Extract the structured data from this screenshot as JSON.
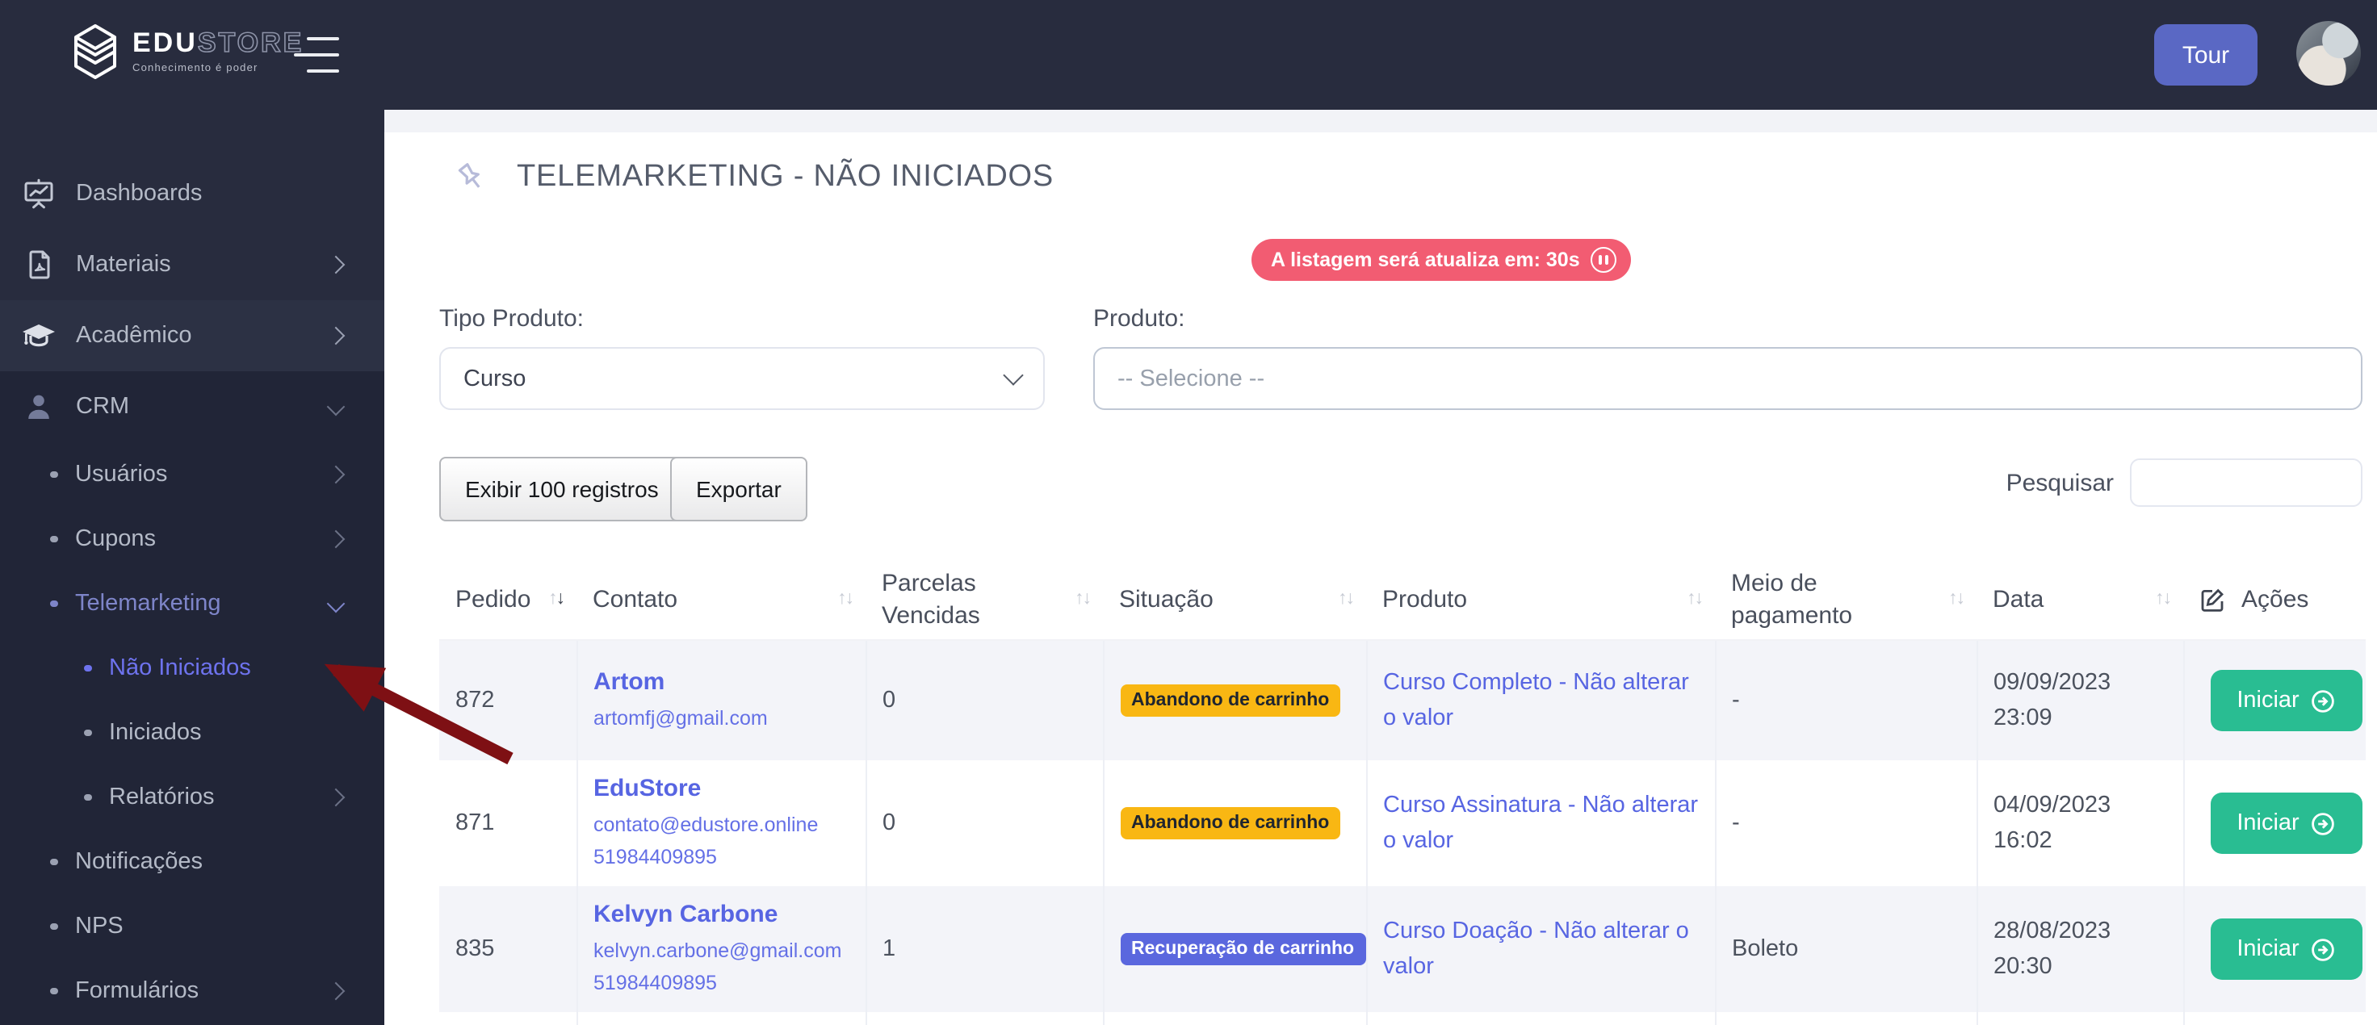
{
  "brand": {
    "edu": "EDU",
    "store": "STORE",
    "tagline": "Conhecimento é poder"
  },
  "topbar": {
    "tour_label": "Tour"
  },
  "sidebar": {
    "dashboards": "Dashboards",
    "materiais": "Materiais",
    "academico": "Acadêmico",
    "crm": "CRM",
    "usuarios": "Usuários",
    "cupons": "Cupons",
    "telemarketing": "Telemarketing",
    "nao_iniciados": "Não Iniciados",
    "iniciados": "Iniciados",
    "relatorios": "Relatórios",
    "notificacoes": "Notificações",
    "nps": "NPS",
    "formularios": "Formulários"
  },
  "page": {
    "title": "TELEMARKETING - NÃO INICIADOS"
  },
  "refresh_banner": {
    "text": "A listagem será atualiza em: 30s"
  },
  "filters": {
    "tipo_label": "Tipo Produto:",
    "tipo_value": "Curso",
    "produto_label": "Produto:",
    "produto_value": "-- Selecione --"
  },
  "toolbar": {
    "exibir_label": "Exibir 100 registros",
    "exportar_label": "Exportar",
    "pesquisar_label": "Pesquisar",
    "search_value": ""
  },
  "table": {
    "headers": {
      "pedido": "Pedido",
      "contato": "Contato",
      "parcelas": "Parcelas Vencidas",
      "situacao": "Situação",
      "produto": "Produto",
      "meio": "Meio de pagamento",
      "data": "Data",
      "acoes": "Ações"
    },
    "sort": {
      "active_column": "pedido",
      "direction": "desc"
    },
    "rows": [
      {
        "pedido": "872",
        "nome": "Artom",
        "email": "artomfj@gmail.com",
        "telefone": "",
        "parcelas": "0",
        "situacao": "Abandono de carrinho",
        "situacao_variant": "warning",
        "produto": "Curso Completo - Não alterar o valor",
        "meio_pagamento": "-",
        "data": "09/09/2023",
        "hora": "23:09",
        "acao_label": "Iniciar"
      },
      {
        "pedido": "871",
        "nome": "EduStore",
        "email": "contato@edustore.online",
        "telefone": "51984409895",
        "parcelas": "0",
        "situacao": "Abandono de carrinho",
        "situacao_variant": "warning",
        "produto": "Curso Assinatura - Não alterar o valor",
        "meio_pagamento": "-",
        "data": "04/09/2023",
        "hora": "16:02",
        "acao_label": "Iniciar"
      },
      {
        "pedido": "835",
        "nome": "Kelvyn Carbone",
        "email": "kelvyn.carbone@gmail.com",
        "telefone": "51984409895",
        "parcelas": "1",
        "situacao": "Recuperação de carrinho",
        "situacao_variant": "info",
        "produto": "Curso Doação - Não alterar o valor",
        "meio_pagamento": "Boleto",
        "data": "28/08/2023",
        "hora": "20:30",
        "acao_label": "Iniciar"
      }
    ]
  },
  "icons": {
    "logo": "edustore-cube-icon",
    "menu_toggle": "hamburger-icon",
    "dashboards": "presentation-chart-icon",
    "materiais": "pdf-file-icon",
    "academico": "graduation-cap-icon",
    "crm": "user-icon",
    "page_pin": "push-pin-icon",
    "banner_pause": "pause-circle-icon",
    "acoes_header": "edit-square-icon",
    "iniciar": "arrow-right-circle-icon",
    "sort": "sort-up-down-icon",
    "annotation": "red-arrow-annotation"
  },
  "colors": {
    "sidebar_bg": "#282c3e",
    "submenu_bg": "#212537",
    "accent_indigo": "#5a68c4",
    "link": "#5765e2",
    "active_item": "#6e73ee",
    "banner_red": "#f25c72",
    "badge_warning": "#f9b713",
    "badge_info": "#5a67de",
    "button_green": "#29bd92",
    "annotation_red": "#7e1014"
  }
}
